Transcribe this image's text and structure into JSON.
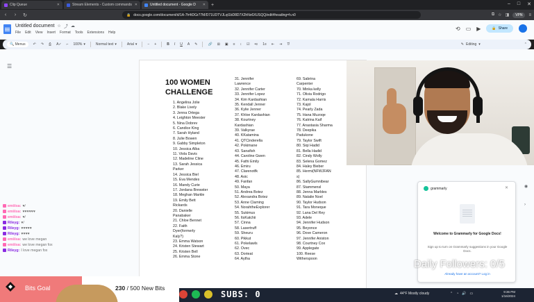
{
  "browser": {
    "tabs": [
      {
        "title": "Clip Queue",
        "color": "#9147ff",
        "active": false
      },
      {
        "title": "Stream Elements - Custom commands",
        "color": "#3b5bdb",
        "active": false
      },
      {
        "title": "Untitled document - Google D",
        "color": "#4285f4",
        "active": true
      }
    ],
    "url": "docs.google.com/document/d/1A-7h4tDGr77M/D71UDTVJLqt1bD8D7X2hNx6XUSQQ/edit#heading=h.n0",
    "vpn_label": "VPN"
  },
  "docs": {
    "title": "Untitled document",
    "menu": [
      "File",
      "Edit",
      "View",
      "Insert",
      "Format",
      "Tools",
      "Extensions",
      "Help"
    ],
    "share_label": "Share",
    "toolbar": {
      "search": "Menus",
      "zoom": "100%",
      "style": "Normal text",
      "font": "Arial",
      "editing": "Editing"
    }
  },
  "document": {
    "heading": "100 WOMEN CHALLENGE",
    "col1": [
      "1. Angelina Jolie",
      "2. Blake Lively",
      "3. Jenna Ortega",
      "4. Leighton Meester",
      "5. Nina Dobrev",
      "6. Candice King",
      "7. Sarah Hyland",
      "8. Julie Bowen",
      "9. Gabby Simpleton",
      "10. Jessica Alba",
      "11. Viola Davis",
      "12. Madeline Cline",
      "13. Sarah Jessica",
      "    Parker",
      "14. Jessica Biel",
      "15. Eva Mendes",
      "16. Mandy Curie",
      "17. Jordana Brewster",
      "18. Meghan Markle",
      "19. Emily Bett",
      "    Rickards",
      "20. Danielle",
      "    Panabaker",
      "21. Chloe Bennet",
      "22. Faith",
      "    Dyer(formerly",
      "    Kaly?)",
      "23. Emma Watson",
      "24. Kristen Stewart",
      "25. Kristen Bell",
      "26. Emma Stone"
    ],
    "col2": [
      "31. Jennifer",
      "    Lawrence",
      "32. Jennifer Carter",
      "33. Jennifer Lopez",
      "34. Kim Kardashian",
      "35. Kendall Jenner",
      "36. Kylie Jenner",
      "37. Khloe Kardashian",
      "38. Kourtney",
      "    Kardashian",
      "39. Valkyrae",
      "40. KKatamina",
      "41. QTCinderella",
      "42. Pokimane",
      "43. Sanafish",
      "44. Caroline Gwen",
      "45. Fathi Emily",
      "46. Emiru",
      "47. Clarenotfk",
      "48. Aoic",
      "49. Fanfan",
      "50. Maya",
      "51. Andrea Botez",
      "52. Alexandra Botez",
      "53. Anne Claming",
      "54. NorahtheExplorer",
      "55. Sukimus",
      "56. ItsKatchii",
      "57. Cinna",
      "58. Lasertruff",
      "59. Sheuru",
      "60. Pikkut",
      "61. Pokelawls",
      "62. Ovec",
      "63. Dorieat",
      "64. Aytha"
    ],
    "col3": [
      "69. Sabrina",
      "    Carpenter",
      "70. Minka kelly",
      "71. Olivia Rodrigo",
      "72. Kamala Harris",
      "73. Kajol",
      "74. Pearly Zada",
      "75. Hana Muzoqe",
      "76. Katrina Kaif",
      "77. Anastasia Sharma",
      "78. Deepika",
      "    Padukone",
      "79. Taylor Swift",
      "80. Siqi Hadid",
      "81. Bella Hadid",
      "82. Cindy Wolly",
      "83. Selena Gomez",
      "84. Haley Bieber",
      "85. Hermi(NFWJFAN",
      "    s)",
      "86. SallyGumnibear",
      "87. Stammensl",
      "88. Jenna Marbles",
      "89. Natalie Noel",
      "90. Taylor Hudson",
      "91. Tara Moneque",
      "92. Lana Del Rey",
      "93. Adele",
      "94. Jennifer Hudson",
      "95. Beyonce",
      "96. Dove Cameron",
      "97. Jennifer Aniston",
      "98. Courtney Cox",
      "99. Applegate",
      "100. Reese",
      "     Witherspoon"
    ]
  },
  "grammarly": {
    "brand": "grammarly",
    "title": "Welcome to Grammarly for Google Docs!",
    "body": "Sign up to turn on Grammarly suggestions in your Google Docs.",
    "link": "Already have an account? Log in"
  },
  "chat": [
    {
      "name": "emiiisa:",
      "text": "♥/",
      "color": "#ff69b4"
    },
    {
      "name": "emiiisa:",
      "text": "♥♥♥♥♥♥",
      "color": "#ff69b4"
    },
    {
      "name": "emiiisa:",
      "text": "♥/",
      "color": "#ff69b4"
    },
    {
      "name": "Rileyg:",
      "text": "♥/",
      "color": "#8a2be2"
    },
    {
      "name": "Rileyg:",
      "text": "♥♥♥♥♥",
      "color": "#8a2be2"
    },
    {
      "name": "Rileyg:",
      "text": "♥♥♥♥",
      "color": "#8a2be2"
    },
    {
      "name": "emiiisa:",
      "text": "we love megan",
      "color": "#ff69b4"
    },
    {
      "name": "emiiisa:",
      "text": "we love megan fox",
      "color": "#ff69b4"
    },
    {
      "name": "Rileyg:",
      "text": "I love megan fox",
      "color": "#8a2be2"
    }
  ],
  "overlay": {
    "followers": "Daily Followers: 0/5",
    "subs": "SUBS: 0"
  },
  "bits": {
    "label": "Bits Goal",
    "current": "230",
    "rest": "/ 500 New Bits",
    "progress": 0.46
  },
  "taskbar": {
    "weather": "44°F Mostly cloudy",
    "time": "9:36 PM",
    "date": "1/16/2024"
  }
}
